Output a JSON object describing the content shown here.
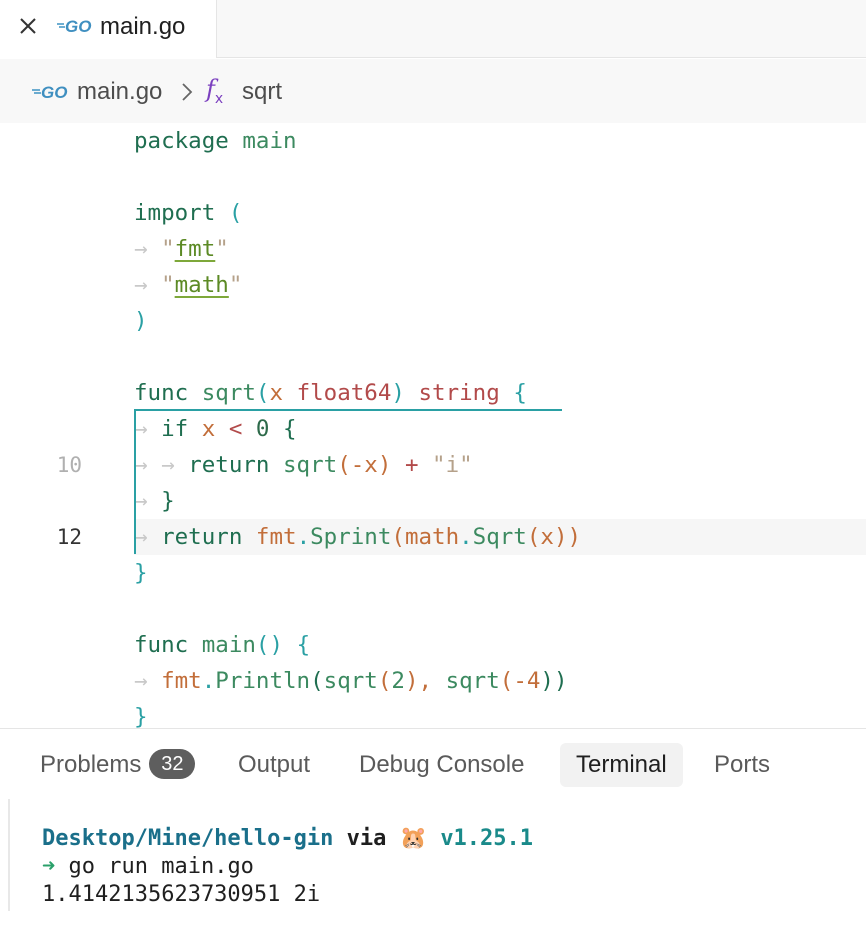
{
  "tabs": [
    {
      "label": "main.go",
      "icon": "go-logo-icon"
    }
  ],
  "breadcrumb": {
    "file": "main.go",
    "fx": "f",
    "fx_sub": "x",
    "symbol": "sqrt"
  },
  "gutter": {
    "line10": "10",
    "line12": "12"
  },
  "code": {
    "l1_kw": "package",
    "l1_name": "main",
    "l3_kw": "import",
    "l3_paren": "(",
    "l4_str": "fmt",
    "l5_str": "math",
    "l6_paren": ")",
    "l8_kw": "func",
    "l8_name": "sqrt",
    "l8_open": "(",
    "l8_param": "x",
    "l8_type": "float64",
    "l8_close": ")",
    "l8_ret": "string",
    "l8_brace": "{",
    "l9_kw": "if",
    "l9_x": "x",
    "l9_op": "<",
    "l9_num": "0",
    "l9_brace": "{",
    "l10_kw": "return",
    "l10_fn": "sqrt",
    "l10_open": "(",
    "l10_arg": "-x",
    "l10_close": ")",
    "l10_op": "+",
    "l10_str": "i",
    "l11_brace": "}",
    "l12_kw": "return",
    "l12_pkg": "fmt",
    "l12_fn": "Sprint",
    "l12_open": "(",
    "l12_pkg2": "math",
    "l12_fn2": "Sqrt",
    "l12_open2": "(",
    "l12_arg": "x",
    "l12_close": "))",
    "l13_brace": "}",
    "l15_kw": "func",
    "l15_name": "main",
    "l15_parens": "()",
    "l15_brace": "{",
    "l16_pkg": "fmt",
    "l16_fn": "Println",
    "l16_open": "(",
    "l16_fn2": "sqrt",
    "l16_open2": "(",
    "l16_num1": "2",
    "l16_close1": "),",
    "l16_fn3": "sqrt",
    "l16_open3": "(",
    "l16_num2": "-4",
    "l16_close2": "))",
    "l17_brace": "}"
  },
  "panel": {
    "tabs": {
      "problems": "Problems",
      "problems_count": "32",
      "output": "Output",
      "debug": "Debug Console",
      "terminal": "Terminal",
      "ports": "Ports"
    },
    "active_tab": "Terminal"
  },
  "terminal": {
    "path": "Desktop/Mine/hello-gin",
    "via": "via",
    "emoji": "🐹",
    "version": "v1.25.1",
    "arrow": "➜",
    "command": "go run main.go",
    "output": "1.4142135623730951 2i"
  },
  "colors": {
    "accent": "#2aa0a4",
    "go_blue": "#3a9bc9"
  }
}
